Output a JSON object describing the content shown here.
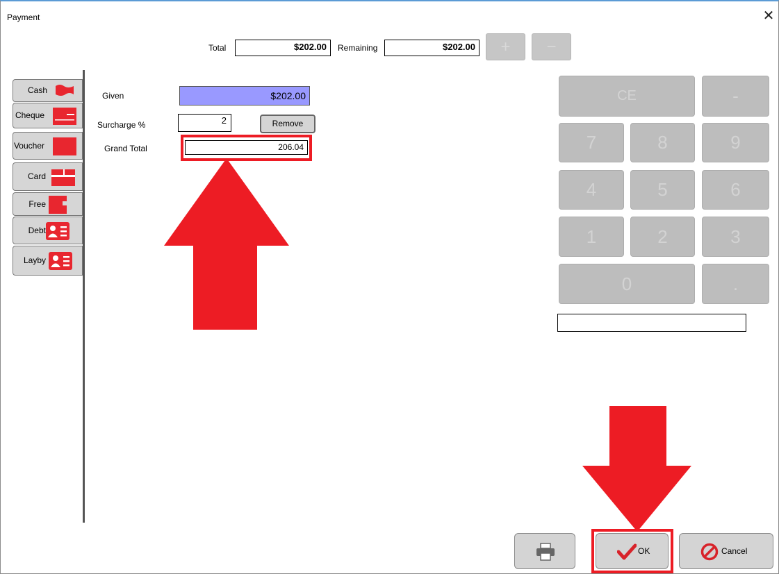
{
  "window": {
    "title": "Payment",
    "close_glyph": "✕"
  },
  "header": {
    "total_label": "Total",
    "total_value": "$202.00",
    "remaining_label": "Remaining",
    "remaining_value": "$202.00",
    "plus_glyph": "+",
    "minus_glyph": "−"
  },
  "tabs": [
    {
      "label": "Cash",
      "icon": "flag-icon"
    },
    {
      "label": "Cheque",
      "icon": "cheque-icon"
    },
    {
      "label": "Voucher",
      "icon": "voucher-icon"
    },
    {
      "label": "Card",
      "icon": "card-icon"
    },
    {
      "label": "Free",
      "icon": "free-icon"
    },
    {
      "label": "Debt",
      "icon": "contact-card-icon"
    },
    {
      "label": "Layby",
      "icon": "contact-card-icon"
    }
  ],
  "form": {
    "given_label": "Given",
    "given_value": "$202.00",
    "surcharge_label": "Surcharge %",
    "surcharge_value": "2",
    "remove_label": "Remove",
    "grand_total_label": "Grand Total",
    "grand_total_value": "206.04"
  },
  "keypad": {
    "keys": [
      "CE",
      "-",
      "7",
      "8",
      "9",
      "4",
      "5",
      "6",
      "1",
      "2",
      "3",
      "0",
      "."
    ],
    "display_value": ""
  },
  "footer": {
    "print_icon": "printer-icon",
    "ok_label": "OK",
    "cancel_label": "Cancel"
  },
  "colors": {
    "annotation_red": "#ed1c24",
    "given_bg": "#9999ff",
    "icon_red": "#e8262f"
  }
}
